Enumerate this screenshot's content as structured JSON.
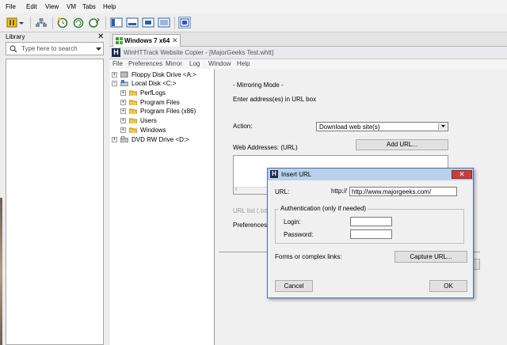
{
  "host_menu": [
    "File",
    "Edit",
    "View",
    "VM",
    "Tabs",
    "Help"
  ],
  "toolbar": {
    "icons": [
      "pause-icon",
      "dropdown-icon",
      "network-icon",
      "snapshot-take-icon",
      "snapshot-revert-icon",
      "snapshot-manager-icon",
      "library-view-icon",
      "console-view-icon",
      "thumbnail-view-icon",
      "fullscreen-icon",
      "unity-icon"
    ]
  },
  "library": {
    "title": "Library",
    "search_placeholder": "Type here to search"
  },
  "vm_tab": {
    "label": "Windows 7 x64"
  },
  "app": {
    "title": "WinHTTrack Website Copier - [MajorGeeks Test.whtt]",
    "menu": [
      "File",
      "Preferences",
      "Mirror",
      "Log",
      "Window",
      "Help"
    ]
  },
  "tree": [
    {
      "label": "Floppy Disk Drive <A:>",
      "exp": "+"
    },
    {
      "label": "Local Disk <C:>",
      "exp": "-"
    },
    {
      "label": "PerfLogs",
      "exp": "+"
    },
    {
      "label": "Program Files",
      "exp": "+"
    },
    {
      "label": "Program Files (x86)",
      "exp": "+"
    },
    {
      "label": "Users",
      "exp": "+"
    },
    {
      "label": "Windows",
      "exp": "+"
    },
    {
      "label": "DVD RW Drive <D:>",
      "exp": "+"
    }
  ],
  "mirror": {
    "mode_label": "- Mirroring Mode -",
    "instruction": "Enter address(es) in URL box",
    "action_label": "Action:",
    "action_value": "Download web site(s)",
    "web_addresses_label": "Web Addresses: (URL)",
    "add_url_button": "Add URL...",
    "url_list_label": "URL list (.txt):",
    "preferences_label": "Preferences a"
  },
  "dialog": {
    "title": "Insert URL",
    "url_label": "URL:",
    "url_prefix": "http://",
    "url_value": "http://www.majorgeeks.com/",
    "auth_group_label": "Authentication (only if needed)",
    "login_label": "Login:",
    "login_value": "",
    "password_label": "Password:",
    "password_value": "",
    "forms_label": "Forms or complex links:",
    "capture_button": "Capture URL...",
    "cancel_button": "Cancel",
    "ok_button": "OK"
  }
}
